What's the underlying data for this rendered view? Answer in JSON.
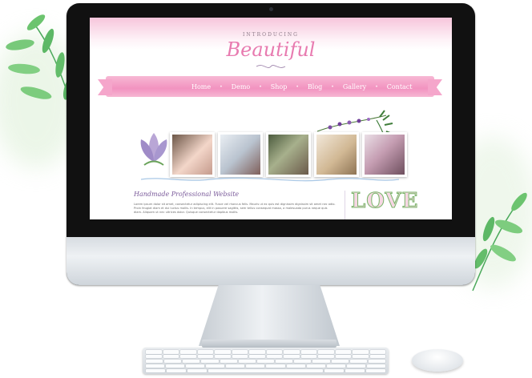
{
  "site": {
    "intro": "INTRODUCING",
    "logo": "Beautiful",
    "nav": [
      "Home",
      "Demo",
      "Shop",
      "Blog",
      "Gallery",
      "Contact"
    ],
    "tagline": "Handmade Professional Website",
    "body_text": "Lorem ipsum dolor sit amet, consectetur adipiscing elit. Fusce vel rhoncus felis. Mauris ut ex quis est dignissim dignissim sit amet nec odio. Proin feugiat diam et dui luctus mollis. In tempus, elit in posuere sagittis, sem tellus consequat massa, a malesuada purus neque quis diam. Aliquam ut nec ultrices dolor. Quisque consectetur dapibus mollis.",
    "sidebar_word": "LOVE"
  },
  "colors": {
    "accent_pink": "#f293c0",
    "logo_pink": "#e87bb0",
    "tagline_purple": "#7a5a9a",
    "leaf_green": "#5fbf6a"
  },
  "icons": [
    "leaf-icon",
    "lotus-flower-icon",
    "flower-sprig-icon"
  ]
}
